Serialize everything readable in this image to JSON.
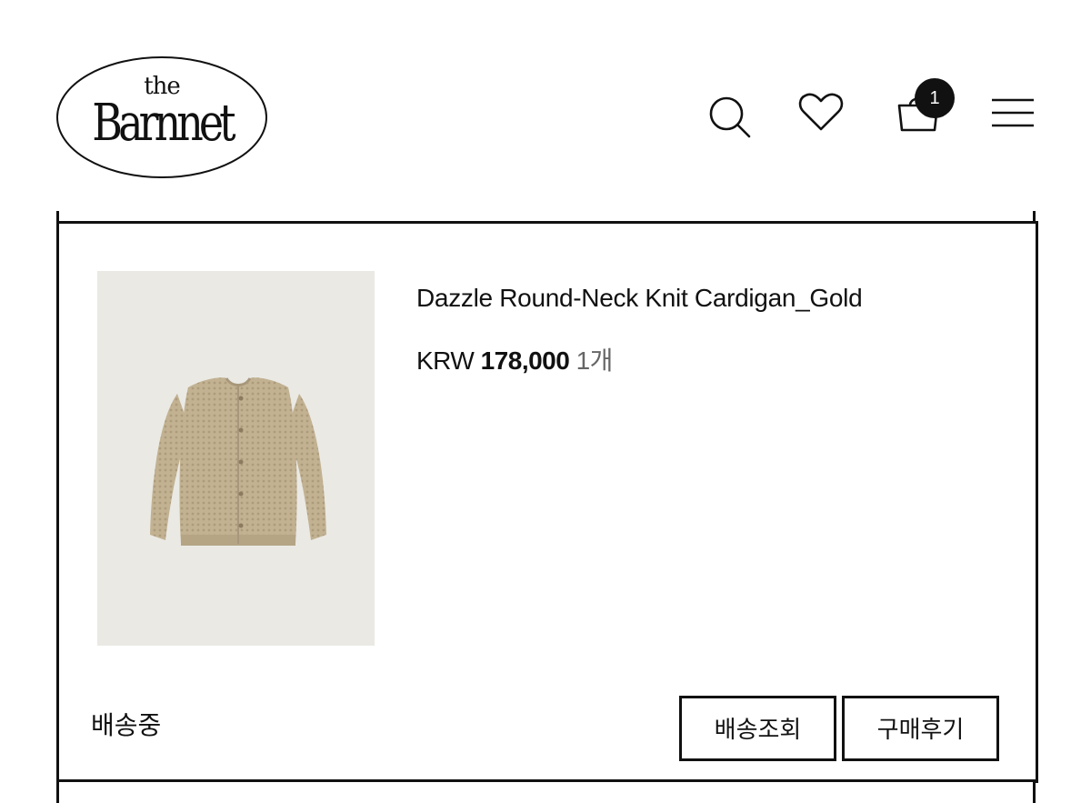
{
  "header": {
    "logo": {
      "small": "the",
      "name": "Barnnet"
    },
    "icons": [
      "search-icon",
      "heart-icon",
      "shopping-bag-icon",
      "menu-icon"
    ],
    "cart_count": "1"
  },
  "order": {
    "product_name": "Dazzle Round-Neck Knit Cardigan_Gold",
    "currency": "KRW",
    "price": "178,000",
    "quantity": "1개",
    "status": "배송중",
    "buttons": {
      "track": "배송조회",
      "review": "구매후기"
    }
  },
  "colors": {
    "text": "#111111",
    "image_bg": "#eae9e4",
    "cardigan": "#c2b292"
  }
}
